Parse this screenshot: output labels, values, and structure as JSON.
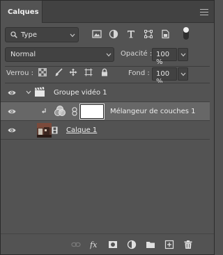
{
  "panel": {
    "tab_label": "Calques"
  },
  "filter": {
    "kind_value": "Type"
  },
  "blend": {
    "mode_value": "Normal",
    "opacity_label": "Opacité :",
    "opacity_value": "100 %",
    "fill_label": "Fond :",
    "fill_value": "100 %",
    "lock_label": "Verrou :"
  },
  "layers": [
    {
      "name": "Groupe vidéo 1",
      "kind": "video-group",
      "visible": true,
      "selected": false
    },
    {
      "name": "Mélangeur de couches 1",
      "kind": "adjustment-channel-mixer",
      "visible": true,
      "selected": true
    },
    {
      "name": "Calque 1",
      "kind": "video-layer",
      "visible": true,
      "selected": false
    }
  ],
  "colors": {
    "panel_bg": "#535353",
    "selected_row": "#676767",
    "text": "#e0e0e0"
  }
}
